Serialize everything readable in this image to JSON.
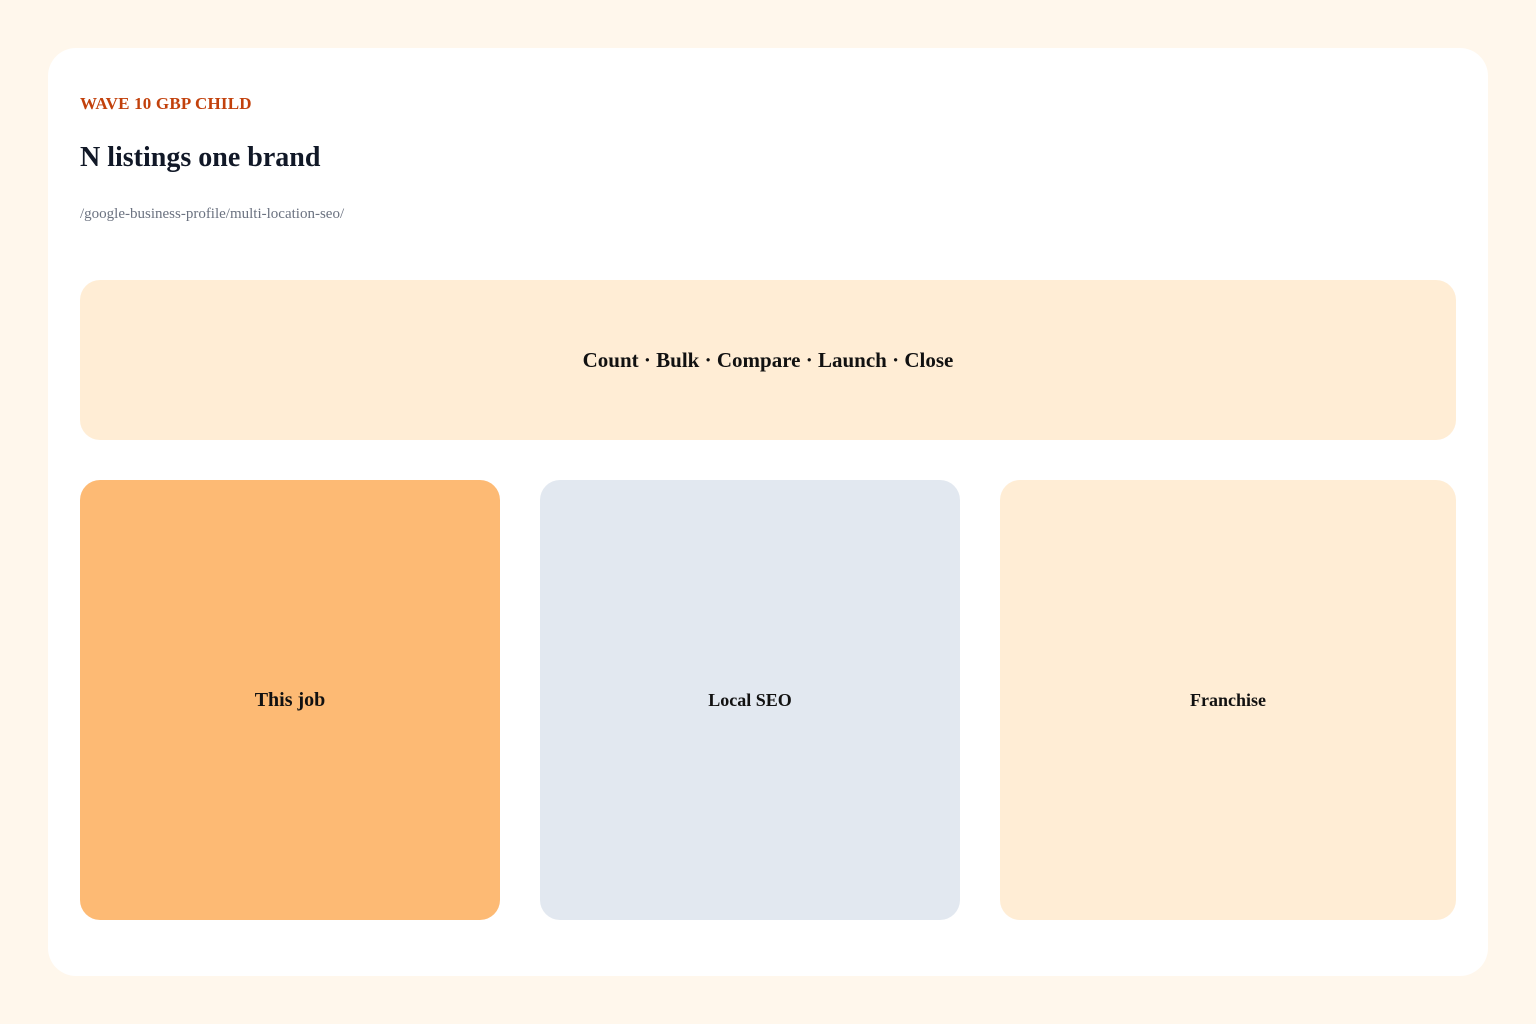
{
  "header": {
    "eyebrow": "WAVE 10 GBP CHILD",
    "title": "N listings one brand",
    "path": "/google-business-profile/multi-location-seo/"
  },
  "banner": {
    "text": "Count · Bulk · Compare · Launch · Close"
  },
  "tiles": [
    {
      "label": "This job",
      "color": "#fdba74"
    },
    {
      "label": "Local SEO",
      "color": "#e2e8f0"
    },
    {
      "label": "Franchise",
      "color": "#ffedd5"
    }
  ],
  "colors": {
    "page_background": "#fff7ec",
    "card_background": "#ffffff",
    "accent": "#c2410c",
    "title": "#111827",
    "muted": "#6b7280"
  }
}
